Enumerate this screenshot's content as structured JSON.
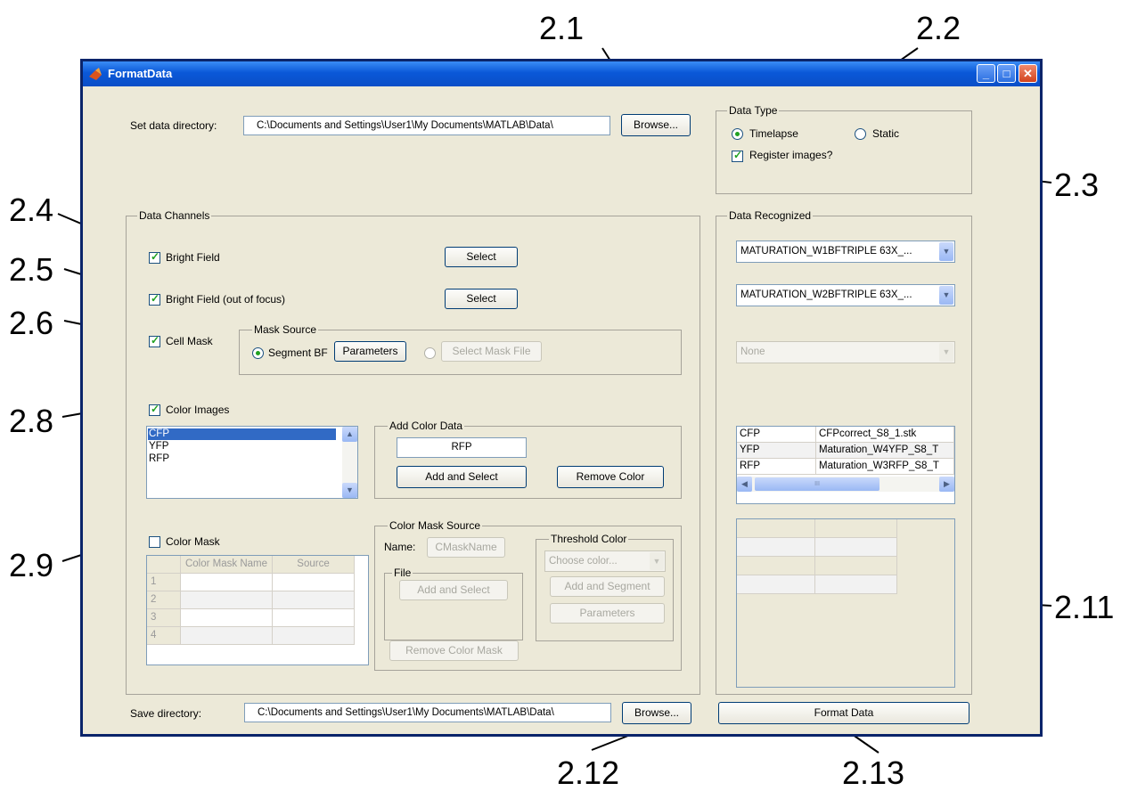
{
  "callouts": [
    "2.1",
    "2.2",
    "2.3",
    "2.4",
    "2.5",
    "2.6",
    "2.8",
    "2.9",
    "2.11",
    "2.12",
    "2.13"
  ],
  "window": {
    "title": "FormatData",
    "minimize_glyph": "_",
    "maximize_glyph": "□",
    "close_glyph": "✕"
  },
  "data_dir": {
    "label": "Set data directory:",
    "value": "C:\\Documents and Settings\\User1\\My Documents\\MATLAB\\Data\\",
    "browse": "Browse..."
  },
  "data_type": {
    "title": "Data Type",
    "timelapse": "Timelapse",
    "static": "Static",
    "register": "Register images?",
    "selected": "Timelapse",
    "register_checked": true
  },
  "channels": {
    "title": "Data Channels",
    "bright_field": "Bright Field",
    "bright_field_oof": "Bright Field (out of focus)",
    "select": "Select",
    "cell_mask": "Cell Mask",
    "mask_source": {
      "title": "Mask Source",
      "segment_bf": "Segment BF",
      "parameters": "Parameters",
      "select_mask_file": "Select Mask File"
    },
    "color_images": "Color Images",
    "colors": [
      "CFP",
      "YFP",
      "RFP"
    ],
    "selected_color": "CFP",
    "add_color": {
      "title": "Add Color Data",
      "value": "RFP",
      "add_and_select": "Add and Select",
      "remove_color": "Remove Color"
    },
    "color_mask": "Color Mask",
    "mask_table": {
      "headers": [
        "Color Mask Name",
        "Source"
      ],
      "row_numbers": [
        "1",
        "2",
        "3",
        "4"
      ]
    },
    "color_mask_source": {
      "title": "Color Mask Source",
      "name_label": "Name:",
      "name_value": "CMaskName",
      "file_title": "File",
      "add_and_select": "Add and Select",
      "remove_color_mask": "Remove Color Mask",
      "threshold_title": "Threshold Color",
      "choose_color": "Choose color...",
      "add_and_segment": "Add and Segment",
      "parameters": "Parameters"
    }
  },
  "recognized": {
    "title": "Data Recognized",
    "bf_select": "MATURATION_W1BFTRIPLE 63X_...",
    "bf_oof_select": "MATURATION_W2BFTRIPLE 63X_...",
    "mask_select": "None",
    "color_table": [
      {
        "channel": "CFP",
        "file": "CFPcorrect_S8_1.stk"
      },
      {
        "channel": "YFP",
        "file": "Maturation_W4YFP_S8_T"
      },
      {
        "channel": "RFP",
        "file": "Maturation_W3RFP_S8_T"
      }
    ],
    "scroll_thumb_glyph": "III"
  },
  "save_dir": {
    "label": "Save directory:",
    "value": "C:\\Documents and Settings\\User1\\My Documents\\MATLAB\\Data\\",
    "browse": "Browse..."
  },
  "format_button": "Format Data",
  "colors": {
    "window_bg": "#ece9d8",
    "titlebar": "#0a58d8",
    "selection": "#316ac5",
    "check": "#21a121"
  }
}
